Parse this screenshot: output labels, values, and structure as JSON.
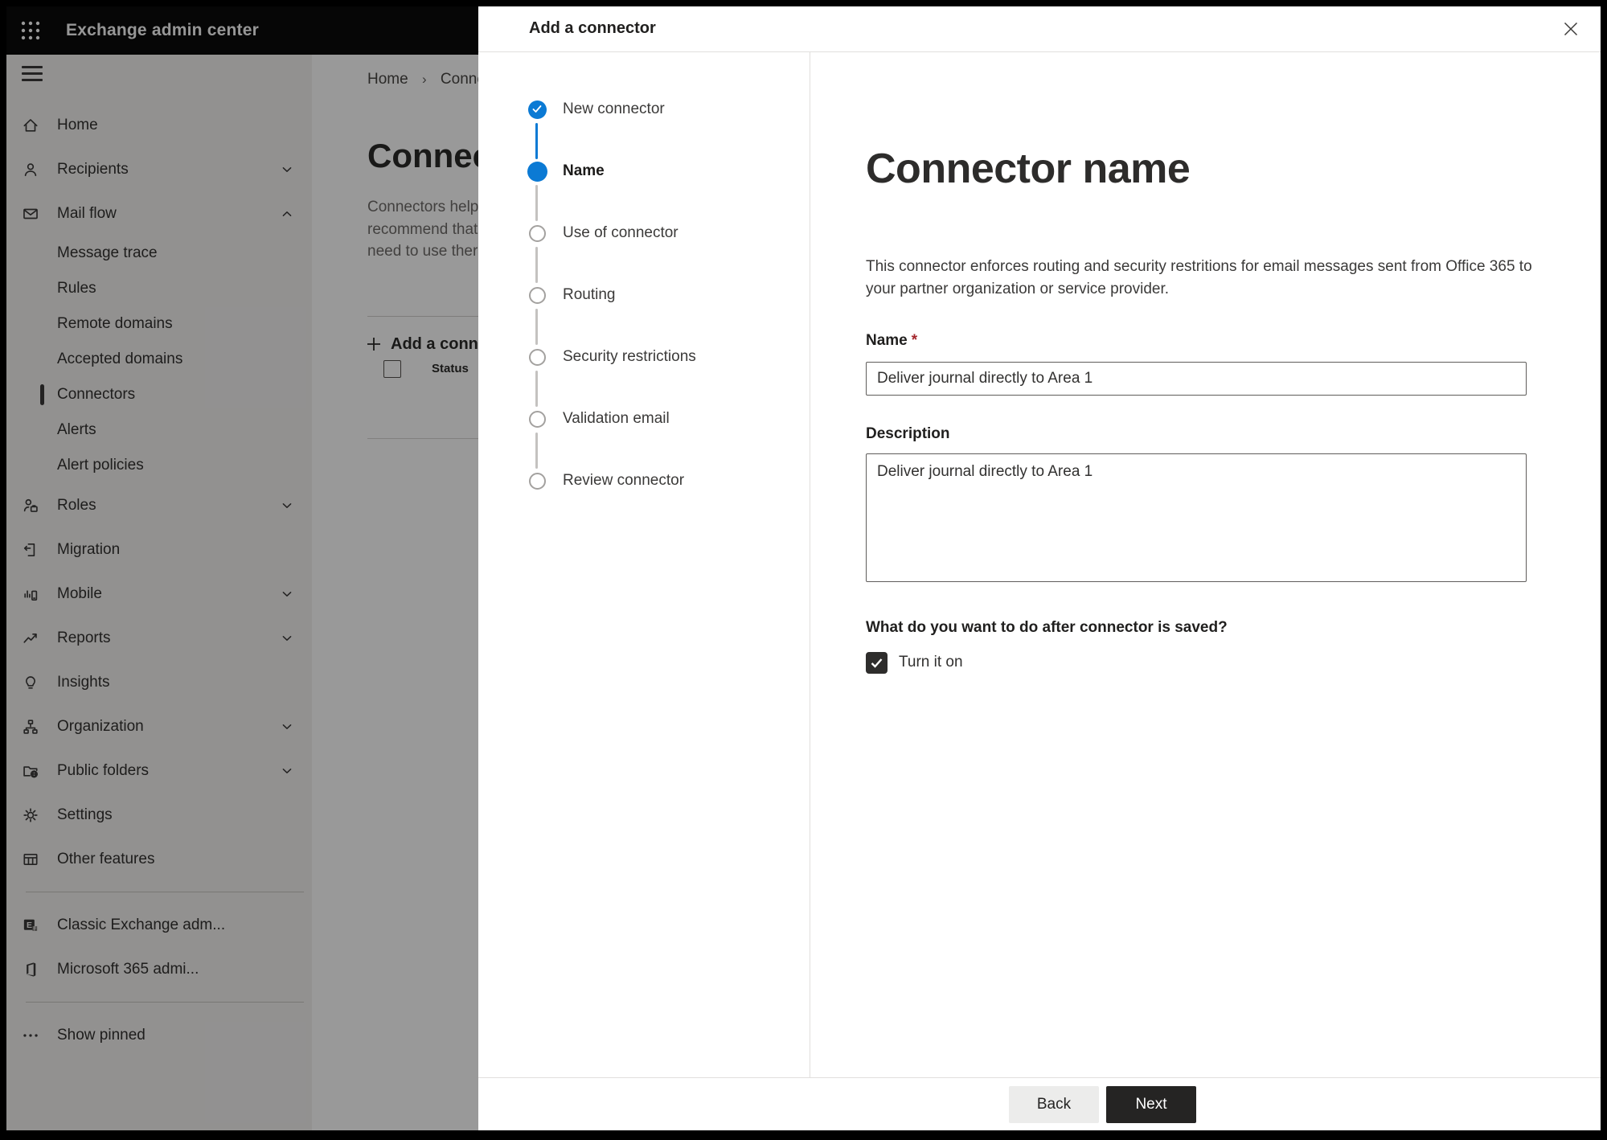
{
  "topbar": {
    "title": "Exchange admin center",
    "waffle_icon": "app-launcher-icon"
  },
  "sidebar": {
    "items": [
      {
        "label": "Home",
        "icon": "home-icon",
        "type": "top"
      },
      {
        "label": "Recipients",
        "icon": "person-icon",
        "type": "top",
        "chevron": "down"
      },
      {
        "label": "Mail flow",
        "icon": "mail-icon",
        "type": "top",
        "chevron": "up"
      },
      {
        "label": "Message trace",
        "type": "sub"
      },
      {
        "label": "Rules",
        "type": "sub"
      },
      {
        "label": "Remote domains",
        "type": "sub"
      },
      {
        "label": "Accepted domains",
        "type": "sub"
      },
      {
        "label": "Connectors",
        "type": "sub",
        "selected": true
      },
      {
        "label": "Alerts",
        "type": "sub"
      },
      {
        "label": "Alert policies",
        "type": "sub"
      },
      {
        "label": "Roles",
        "icon": "roles-icon",
        "type": "top",
        "chevron": "down"
      },
      {
        "label": "Migration",
        "icon": "migration-icon",
        "type": "top"
      },
      {
        "label": "Mobile",
        "icon": "mobile-icon",
        "type": "top",
        "chevron": "down"
      },
      {
        "label": "Reports",
        "icon": "reports-icon",
        "type": "top",
        "chevron": "down"
      },
      {
        "label": "Insights",
        "icon": "insights-icon",
        "type": "top"
      },
      {
        "label": "Organization",
        "icon": "organization-icon",
        "type": "top",
        "chevron": "down"
      },
      {
        "label": "Public folders",
        "icon": "public-folders-icon",
        "type": "top",
        "chevron": "down"
      },
      {
        "label": "Settings",
        "icon": "settings-icon",
        "type": "top"
      },
      {
        "label": "Other features",
        "icon": "other-features-icon",
        "type": "top"
      },
      {
        "type": "divider"
      },
      {
        "label": "Classic Exchange adm...",
        "icon": "classic-exchange-icon",
        "type": "top"
      },
      {
        "label": "Microsoft 365 admi...",
        "icon": "microsoft-365-icon",
        "type": "top"
      },
      {
        "type": "divider"
      },
      {
        "label": "Show pinned",
        "icon": "ellipsis-icon",
        "type": "top"
      }
    ]
  },
  "page": {
    "breadcrumb": [
      "Home",
      "Connectors"
    ],
    "title": "Connectors",
    "description_lines": [
      "Connectors help",
      "recommend that",
      "need to use ther"
    ],
    "add_button_label": "Add a connector",
    "table": {
      "status_column": "Status"
    }
  },
  "dialog": {
    "title": "Add a connector",
    "close_icon": "close-icon",
    "steps": [
      {
        "label": "New connector",
        "state": "completed"
      },
      {
        "label": "Name",
        "state": "current"
      },
      {
        "label": "Use of connector",
        "state": "upcoming"
      },
      {
        "label": "Routing",
        "state": "upcoming"
      },
      {
        "label": "Security restrictions",
        "state": "upcoming"
      },
      {
        "label": "Validation email",
        "state": "upcoming"
      },
      {
        "label": "Review connector",
        "state": "upcoming"
      }
    ],
    "content": {
      "heading": "Connector name",
      "description": "This connector enforces routing and security restritions for email messages sent from Office 365 to your partner organization or service provider.",
      "name_label": "Name",
      "required_marker": "*",
      "name_value": "Deliver journal directly to Area 1",
      "description_label": "Description",
      "description_value": "Deliver journal directly to Area 1",
      "after_save_question": "What do you want to do after connector is saved?",
      "turn_on_label": "Turn it on",
      "turn_on_checked": true
    },
    "footer": {
      "back_label": "Back",
      "next_label": "Next"
    },
    "colors": {
      "accent": "#0b7ad4",
      "next_button_bg": "#252423",
      "required": "#a4262c"
    }
  }
}
